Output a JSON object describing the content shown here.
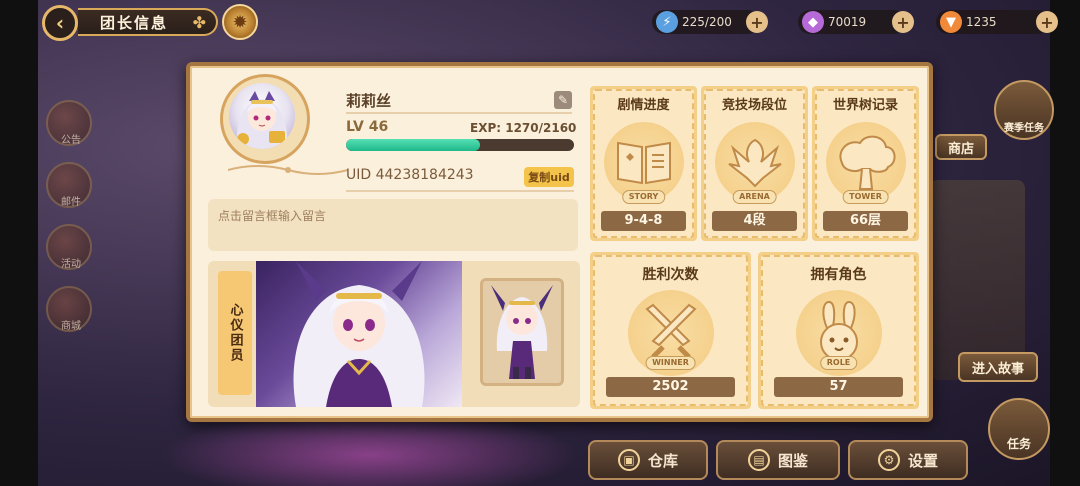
{
  "topbar": {
    "back_icon": "back-arrow-icon",
    "title": "团长信息",
    "resources": [
      {
        "icon": "stamina-icon",
        "value": "225/200"
      },
      {
        "icon": "gem-icon",
        "value": "70019"
      },
      {
        "icon": "carrot-icon",
        "value": "1235"
      }
    ]
  },
  "sidebar": {
    "items": [
      {
        "label": "公告"
      },
      {
        "label": "邮件"
      },
      {
        "label": "活动"
      },
      {
        "label": "商城"
      }
    ]
  },
  "profile": {
    "name": "莉莉丝",
    "level": "LV 46",
    "exp_text": "EXP: 1270/2160",
    "exp_ratio": 0.588,
    "uid": "UID 44238184243",
    "copy_label": "复制uid",
    "message_placeholder": "点击留言框输入留言",
    "showcase_tag": "心仪团员"
  },
  "stats": [
    {
      "title": "剧情进度",
      "icon": "story-book-icon",
      "ribbon": "STORY",
      "value": "9-4-8"
    },
    {
      "title": "竞技场段位",
      "icon": "arena-eagle-icon",
      "ribbon": "ARENA",
      "value": "4段"
    },
    {
      "title": "世界树记录",
      "icon": "tower-tree-icon",
      "ribbon": "TOWER",
      "value": "66层"
    },
    {
      "title": "胜利次数",
      "icon": "crossed-swords-icon",
      "ribbon": "WINNER",
      "value": "2502"
    },
    {
      "title": "拥有角色",
      "icon": "bunny-face-icon",
      "ribbon": "ROLE",
      "value": "57"
    }
  ],
  "right_fragments": {
    "season_task": "赛季任务",
    "shop": "商店",
    "enter_story": "进入故事",
    "task": "任务"
  },
  "bottom_buttons": [
    {
      "label": "仓库",
      "icon": "warehouse-icon"
    },
    {
      "label": "图鉴",
      "icon": "book-icon"
    },
    {
      "label": "设置",
      "icon": "settings-icon"
    }
  ],
  "colors": {
    "modal_bg": "#fbf0dc",
    "modal_border": "#a57640",
    "exp_fill": "#1fb88a",
    "value_plate": "#8c6844",
    "copy_button": "#f4c34a"
  }
}
